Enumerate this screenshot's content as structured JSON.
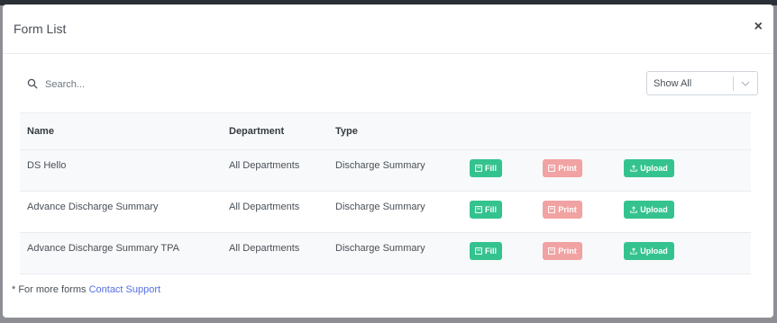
{
  "modal": {
    "title": "Form List",
    "close_symbol": "×"
  },
  "search": {
    "placeholder": "Search...",
    "icon": "search-icon"
  },
  "filter": {
    "selected": "Show All"
  },
  "table": {
    "headers": [
      "Name",
      "Department",
      "Type"
    ],
    "rows": [
      {
        "name": "DS Hello",
        "department": "All Departments",
        "type": "Discharge Summary"
      },
      {
        "name": "Advance Discharge Summary",
        "department": "All Departments",
        "type": "Discharge Summary"
      },
      {
        "name": "Advance Discharge Summary TPA",
        "department": "All Departments",
        "type": "Discharge Summary"
      }
    ],
    "actions": {
      "fill": "Fill",
      "print": "Print",
      "upload": "Upload"
    }
  },
  "footer": {
    "prefix": "* For more forms ",
    "link": "Contact Support"
  },
  "colors": {
    "fill_button": "#34c38f",
    "print_button": "#f1a2a2",
    "upload_button": "#34c38f",
    "link": "#556ee6"
  }
}
